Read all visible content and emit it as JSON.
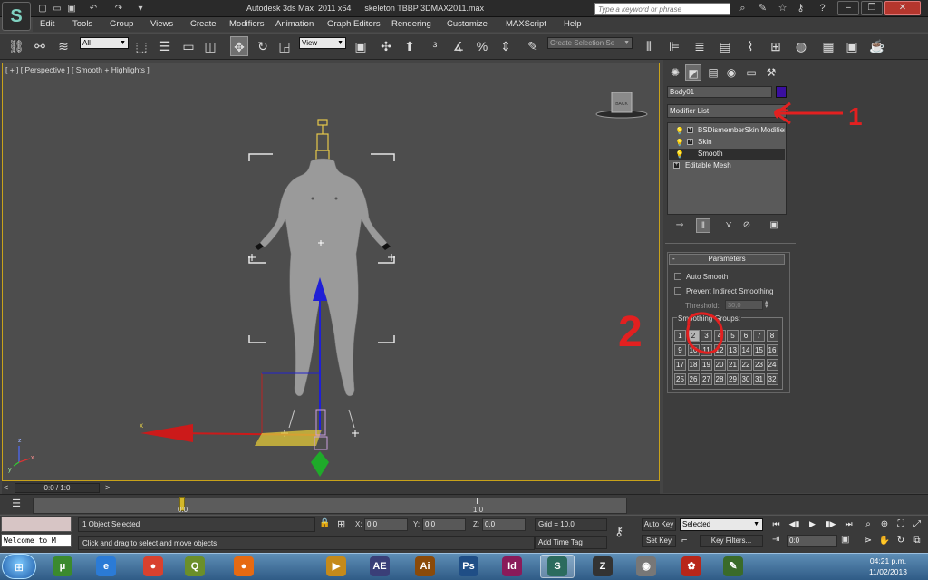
{
  "titlebar": {
    "title": "Autodesk 3ds Max  2011 x64      skeleton TBBP 3DMAX2011.max",
    "search_placeholder": "Type a keyword or phrase",
    "icons": [
      "new-file-icon",
      "open-file-icon",
      "save-icon",
      "undo-icon",
      "redo-icon",
      "dropdown-icon"
    ],
    "help_icons": [
      "binoculars-icon",
      "star-icon",
      "key-icon",
      "help-icon"
    ],
    "window_buttons": [
      "minimize-icon",
      "maximize-icon",
      "close-icon"
    ]
  },
  "menu": [
    "Edit",
    "Tools",
    "Group",
    "Views",
    "Create",
    "Modifiers",
    "Animation",
    "Graph Editors",
    "Rendering",
    "Customize",
    "MAXScript",
    "Help"
  ],
  "toolbar": {
    "selection_filter": "All",
    "reference_coord": "View",
    "named_selection_placeholder": "Create Selection Se"
  },
  "viewport": {
    "label": "[ + ] [ Perspective ] [ Smooth + Highlights ]",
    "viewcube_label": "BACK",
    "axis_x": "x",
    "axis_tripod": [
      "z",
      "x",
      "y"
    ]
  },
  "command_panel": {
    "object_name": "Body01",
    "object_color": "#3a0fa0",
    "modifier_list_label": "Modifier List",
    "stack": [
      {
        "label": "BSDismemberSkin Modifier",
        "bulb": true,
        "expand": "+"
      },
      {
        "label": "Skin",
        "bulb": true,
        "expand": "+"
      },
      {
        "label": "Smooth",
        "bulb": true,
        "expand": "",
        "selected": true
      },
      {
        "label": "Editable Mesh",
        "bulb": false,
        "expand": "+"
      }
    ],
    "rollout": {
      "header": "Parameters",
      "collapse": "-",
      "auto_smooth": "Auto Smooth",
      "prevent_indirect": "Prevent Indirect Smoothing",
      "threshold_label": "Threshold:",
      "threshold_value": "30,0",
      "smoothing_groups_label": "Smoothing Groups:",
      "groups": [
        "1",
        "2",
        "3",
        "4",
        "5",
        "6",
        "7",
        "8",
        "9",
        "10",
        "11",
        "12",
        "13",
        "14",
        "15",
        "16",
        "17",
        "18",
        "19",
        "20",
        "21",
        "22",
        "23",
        "24",
        "25",
        "26",
        "27",
        "28",
        "29",
        "30",
        "31",
        "32"
      ],
      "active_groups": [
        "2"
      ]
    }
  },
  "annotations": {
    "one": "1",
    "two": "2"
  },
  "timeline": {
    "frame_readout": "0:0 / 1:0",
    "prev": "<",
    "next": ">",
    "track_start": "0:0",
    "track_end": "1:0"
  },
  "status": {
    "maxscript_text": "Welcome to M",
    "selection": "1 Object Selected",
    "prompt": "Click and drag to select and move objects",
    "x_label": "X:",
    "y_label": "Y:",
    "z_label": "Z:",
    "x_value": "0,0",
    "y_value": "0,0",
    "z_value": "0,0",
    "grid": "Grid = 10,0",
    "add_time_tag": "Add Time Tag",
    "auto_key": "Auto Key",
    "set_key": "Set Key",
    "selected_dropdown": "Selected",
    "key_filters": "Key Filters...",
    "current_frame": "0:0"
  },
  "taskbar": {
    "apps": [
      {
        "name": "utorrent",
        "glyph": "μ",
        "color": "#3b8a2e"
      },
      {
        "name": "internet-explorer",
        "glyph": "e",
        "color": "#2b7bd6"
      },
      {
        "name": "chrome",
        "glyph": "●",
        "color": "#d8412f"
      },
      {
        "name": "quicktime-app",
        "glyph": "Q",
        "color": "#6b8f2a"
      },
      {
        "name": "firefox",
        "glyph": "●",
        "color": "#e66a12"
      },
      {
        "name": "slide-app",
        "glyph": "▶",
        "color": "#c58a1a"
      },
      {
        "name": "after-effects",
        "glyph": "AE",
        "color": "#3a3f78"
      },
      {
        "name": "illustrator",
        "glyph": "Ai",
        "color": "#8a4a0a"
      },
      {
        "name": "photoshop",
        "glyph": "Ps",
        "color": "#1f4e86"
      },
      {
        "name": "indesign",
        "glyph": "Id",
        "color": "#8a1b5a"
      },
      {
        "name": "3dsmax",
        "glyph": "S",
        "color": "#2b6b5e",
        "active": true
      },
      {
        "name": "zbrush",
        "glyph": "Z",
        "color": "#333333"
      },
      {
        "name": "dvd-app",
        "glyph": "◉",
        "color": "#777777"
      },
      {
        "name": "dragon-app",
        "glyph": "✿",
        "color": "#b8261a"
      },
      {
        "name": "paint-app",
        "glyph": "✎",
        "color": "#3a6b2a"
      }
    ],
    "time": "04:21 p.m.",
    "date": "11/02/2013"
  }
}
